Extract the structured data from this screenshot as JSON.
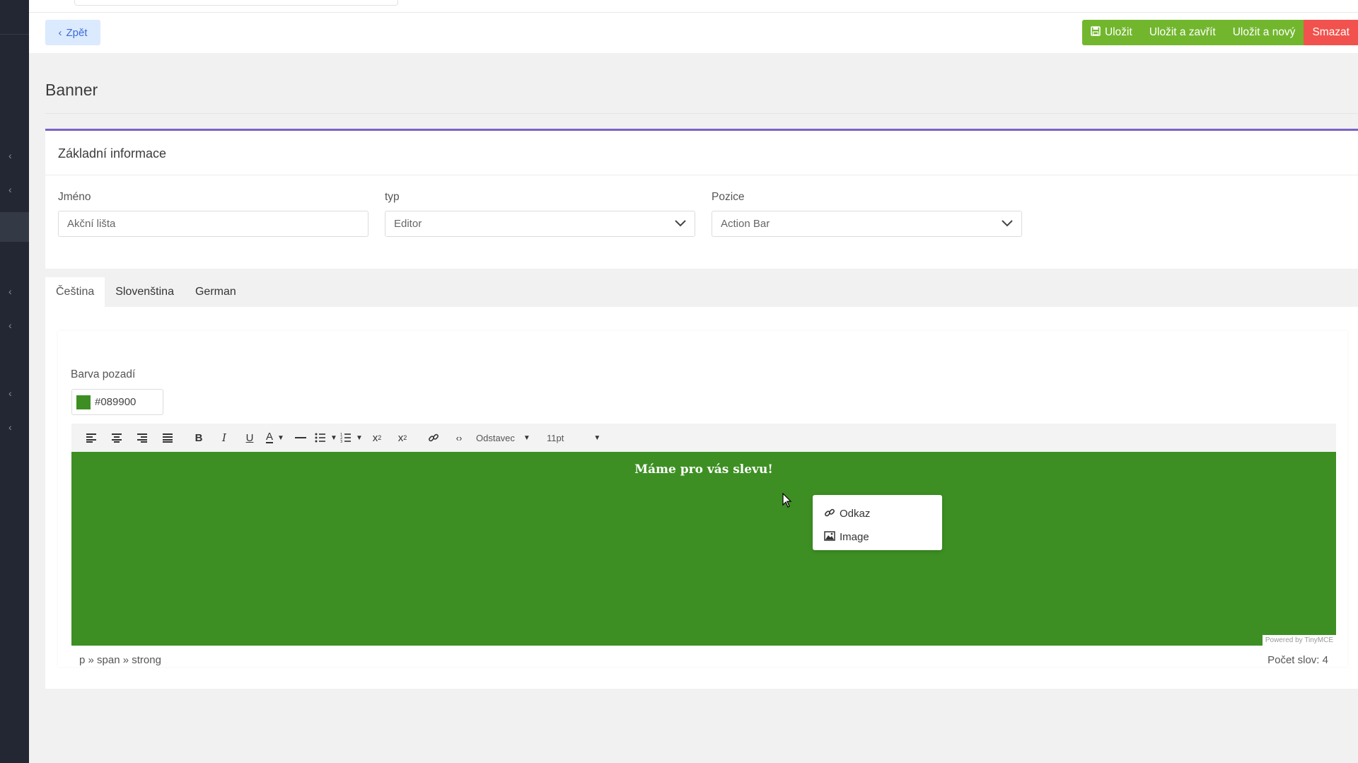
{
  "header": {
    "back_label": "Zpět",
    "save_label": "Uložit",
    "save_close_label": "Uložit a zavřít",
    "save_new_label": "Uložit a nový",
    "delete_label": "Smazat"
  },
  "page": {
    "title": "Banner"
  },
  "basic_info": {
    "title": "Základní informace",
    "name_label": "Jméno",
    "name_placeholder": "Akční lišta",
    "type_label": "typ",
    "type_value": "Editor",
    "position_label": "Pozice",
    "position_value": "Action Bar"
  },
  "tabs": [
    {
      "label": "Čeština",
      "active": true
    },
    {
      "label": "Slovenština",
      "active": false
    },
    {
      "label": "German",
      "active": false
    }
  ],
  "editor": {
    "bg_label": "Barva pozadí",
    "bg_color": "#089900",
    "toolbar": {
      "format_label": "Odstavec",
      "size_label": "11pt"
    },
    "content": "Máme pro vás slevu!",
    "powered_by": "Powered by TinyMCE",
    "path": "p » span » strong",
    "word_count": "Počet slov: 4"
  },
  "context_menu": [
    {
      "label": "Odkaz",
      "icon": "link-icon"
    },
    {
      "label": "Image",
      "icon": "image-icon"
    }
  ],
  "colors": {
    "sidebar": "#232734",
    "accent": "#7a63c6",
    "save_green": "#72b62e",
    "delete_red": "#f1524d",
    "editor_green": "#3d8f23"
  }
}
